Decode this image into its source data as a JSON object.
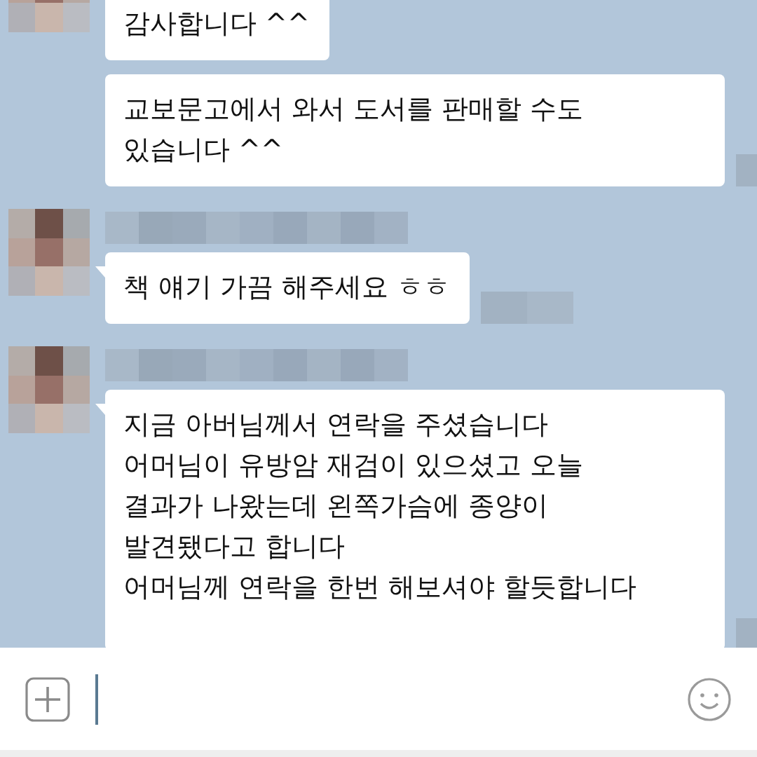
{
  "chat": {
    "groups": [
      {
        "kind": "continued",
        "messages": [
          {
            "text": "감사합니다 ^^"
          },
          {
            "text": "교보문고에서 와서 도서를 판매할 수도\n있습니다  ^^"
          }
        ]
      },
      {
        "kind": "incoming",
        "messages": [
          {
            "text": "책 얘기 가끔 해주세요 ㅎㅎ"
          }
        ]
      },
      {
        "kind": "incoming",
        "messages": [
          {
            "text": "지금 아버님께서 연락을 주셨습니다\n어머님이 유방암 재검이 있으셨고 오늘\n결과가 나왔는데 왼쪽가슴에 종양이\n발견됐다고 합니다\n어머님께 연락을 한번 해보셔야 할듯합니다"
          }
        ]
      }
    ]
  }
}
